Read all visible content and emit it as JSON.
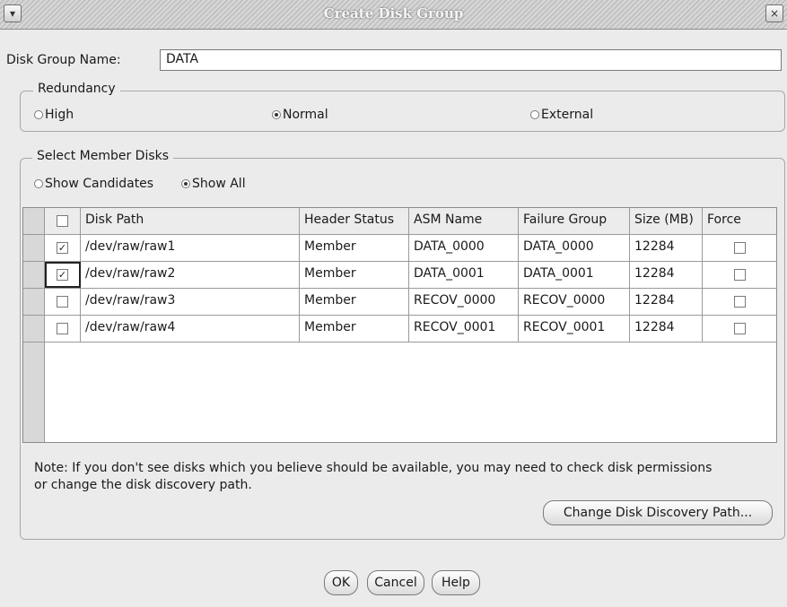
{
  "window": {
    "title": "Create Disk Group",
    "menu_icon": "chevron-down-icon",
    "close_icon": "close-icon",
    "close_glyph": "×"
  },
  "disk_group_name": {
    "label": "Disk Group Name:",
    "value": "DATA"
  },
  "redundancy": {
    "legend": "Redundancy",
    "options": [
      {
        "label": "High",
        "selected": false
      },
      {
        "label": "Normal",
        "selected": true
      },
      {
        "label": "External",
        "selected": false
      }
    ]
  },
  "member_disks": {
    "legend": "Select Member Disks",
    "filter_options": [
      {
        "label": "Show Candidates",
        "selected": false
      },
      {
        "label": "Show All",
        "selected": true
      }
    ],
    "table": {
      "columns": [
        "Disk Path",
        "Header Status",
        "ASM Name",
        "Failure Group",
        "Size (MB)",
        "Force"
      ],
      "rows": [
        {
          "selected": true,
          "disk_path": "/dev/raw/raw1",
          "header_status": "Member",
          "asm_name": "DATA_0000",
          "failure_group": "DATA_0000",
          "size_mb": "12284",
          "force": false
        },
        {
          "selected": true,
          "disk_path": "/dev/raw/raw2",
          "header_status": "Member",
          "asm_name": "DATA_0001",
          "failure_group": "DATA_0001",
          "size_mb": "12284",
          "force": false
        },
        {
          "selected": false,
          "disk_path": "/dev/raw/raw3",
          "header_status": "Member",
          "asm_name": "RECOV_0000",
          "failure_group": "RECOV_0000",
          "size_mb": "12284",
          "force": false
        },
        {
          "selected": false,
          "disk_path": "/dev/raw/raw4",
          "header_status": "Member",
          "asm_name": "RECOV_0001",
          "failure_group": "RECOV_0001",
          "size_mb": "12284",
          "force": false
        }
      ]
    },
    "note": "Note: If you don't see disks which you believe should be available, you may need to check disk permissions or change the disk discovery path.",
    "change_path_button": "Change Disk Discovery Path..."
  },
  "buttons": {
    "ok": "OK",
    "cancel": "Cancel",
    "help": "Help"
  },
  "check_glyph": "✓"
}
